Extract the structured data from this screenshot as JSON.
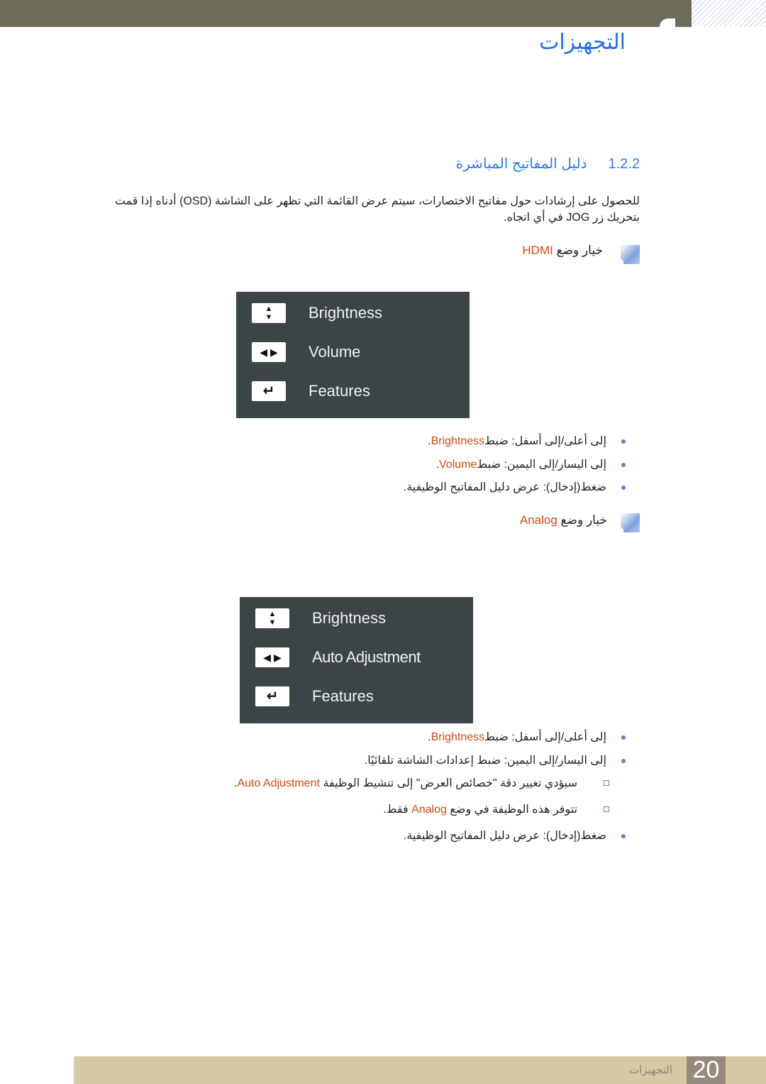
{
  "header": {
    "title": "التجهيزات"
  },
  "section": {
    "number": "1.2.2",
    "title": "دليل المفاتيح المباشرة"
  },
  "intro": "للحصول على إرشادات حول مفاتيح الاختصارات، سيتم عرض القائمة التي تظهر على الشاشة (OSD) أدناه إذا قمت بتحريك زر JOG في أي اتجاه.",
  "hdmi": {
    "heading_prefix": "خيار وضع ",
    "heading_mode": "HDMI",
    "osd": [
      {
        "icon": "up-down-arrows-icon",
        "glyph": "▲▼",
        "label": "Brightness"
      },
      {
        "icon": "left-right-arrows-icon",
        "glyph": "◀ ▶",
        "label": "Volume"
      },
      {
        "icon": "enter-icon",
        "glyph": "↵",
        "label": "Features"
      }
    ],
    "bullets": [
      {
        "text": "إلى أعلى/إلى أسفل: ضبط",
        "term": "Brightness",
        "end": "."
      },
      {
        "text": "إلى اليسار/إلى اليمين: ضبط",
        "term": "Volume",
        "end": "."
      },
      {
        "text": "ضغط(إدخال): عرض دليل المفاتيح الوظيفية.",
        "term": "",
        "end": ""
      }
    ]
  },
  "analog": {
    "heading_prefix": "خيار وضع ",
    "heading_mode": "Analog",
    "osd": [
      {
        "icon": "up-down-arrows-icon",
        "glyph": "▲▼",
        "label": "Brightness"
      },
      {
        "icon": "left-right-arrows-icon",
        "glyph": "◀ ▶",
        "label": "Auto Adjustment"
      },
      {
        "icon": "enter-icon",
        "glyph": "↵",
        "label": "Features"
      }
    ],
    "bullets": [
      {
        "text": "إلى أعلى/إلى أسفل: ضبط",
        "term": "Brightness",
        "end": "."
      },
      {
        "text": "إلى اليسار/إلى اليمين: ضبط إعدادات الشاشة تلقائيًا.",
        "term": "",
        "end": ""
      },
      {
        "text": "سيؤدي تغيير دقة \"خصائص العرض\" إلى تنشيط الوظيفة ",
        "term": "Auto Adjustment",
        "end": "."
      },
      {
        "text": "تتوفر هذه الوظيفة في وضع ",
        "term": "Analog",
        "end": " فقط."
      },
      {
        "text": "ضغط(إدخال): عرض دليل المفاتيح الوظيفية.",
        "term": "",
        "end": ""
      }
    ]
  },
  "footer": {
    "page": "20",
    "chapter": "التجهيزات"
  },
  "colors": {
    "accent": "#1f6ef0",
    "term": "#d24a10",
    "osd_bg": "#3b4446",
    "header_bar": "#6e6c58",
    "footer_bar": "#d6c9a6"
  }
}
